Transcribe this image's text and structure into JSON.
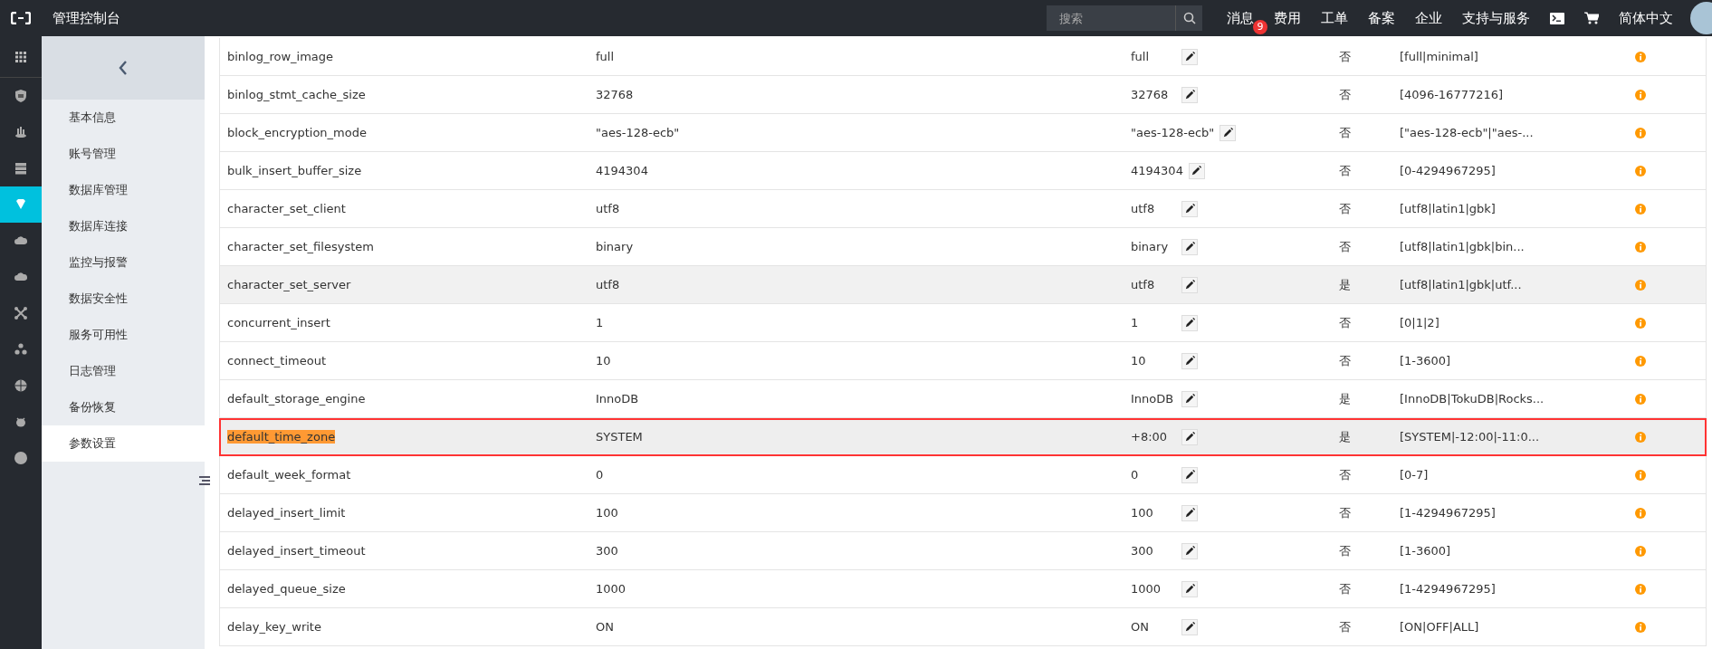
{
  "topbar": {
    "title": "管理控制台",
    "search": {
      "placeholder": "搜索"
    },
    "nav": [
      {
        "kind": "text",
        "label": "消息",
        "badge": "9"
      },
      {
        "kind": "text",
        "label": "费用"
      },
      {
        "kind": "text",
        "label": "工单"
      },
      {
        "kind": "text",
        "label": "备案"
      },
      {
        "kind": "text",
        "label": "企业"
      },
      {
        "kind": "text",
        "label": "支持与服务"
      },
      {
        "kind": "terminal"
      },
      {
        "kind": "cart"
      },
      {
        "kind": "text",
        "label": "简体中文"
      },
      {
        "kind": "avatar"
      }
    ]
  },
  "rail": {
    "items": [
      {
        "kind": "grid",
        "selected": false
      },
      {
        "kind": "shield",
        "selected": false
      },
      {
        "kind": "bars",
        "selected": false
      },
      {
        "kind": "server",
        "selected": false
      },
      {
        "kind": "gem",
        "selected": true
      },
      {
        "kind": "cloud",
        "selected": false
      },
      {
        "kind": "cloud",
        "selected": false
      },
      {
        "kind": "cross",
        "selected": false
      },
      {
        "kind": "nodes",
        "selected": false
      },
      {
        "kind": "globe",
        "selected": false
      },
      {
        "kind": "bug",
        "selected": false
      },
      {
        "kind": "dot",
        "selected": false
      }
    ]
  },
  "sidebar": {
    "items": [
      {
        "label": "基本信息",
        "selected": false
      },
      {
        "label": "账号管理",
        "selected": false
      },
      {
        "label": "数据库管理",
        "selected": false
      },
      {
        "label": "数据库连接",
        "selected": false
      },
      {
        "label": "监控与报警",
        "selected": false
      },
      {
        "label": "数据安全性",
        "selected": false
      },
      {
        "label": "服务可用性",
        "selected": false
      },
      {
        "label": "日志管理",
        "selected": false
      },
      {
        "label": "备份恢复",
        "selected": false
      },
      {
        "label": "参数设置",
        "selected": true
      }
    ]
  },
  "parameters": {
    "rows": [
      {
        "name": "binlog_row_image",
        "value": "full",
        "modified_value": "full",
        "restart": "否",
        "range": "[full|minimal]",
        "shaded": false,
        "highlighted": false,
        "name_marked": false
      },
      {
        "name": "binlog_stmt_cache_size",
        "value": "32768",
        "modified_value": "32768",
        "restart": "否",
        "range": "[4096-16777216]",
        "shaded": false,
        "highlighted": false,
        "name_marked": false
      },
      {
        "name": "block_encryption_mode",
        "value": "\"aes-128-ecb\"",
        "modified_value": "\"aes-128-ecb\"",
        "restart": "否",
        "range": "[\"aes-128-ecb\"|\"aes-...",
        "shaded": false,
        "highlighted": false,
        "name_marked": false
      },
      {
        "name": "bulk_insert_buffer_size",
        "value": "4194304",
        "modified_value": "4194304",
        "restart": "否",
        "range": "[0-4294967295]",
        "shaded": false,
        "highlighted": false,
        "name_marked": false
      },
      {
        "name": "character_set_client",
        "value": "utf8",
        "modified_value": "utf8",
        "restart": "否",
        "range": "[utf8|latin1|gbk]",
        "shaded": false,
        "highlighted": false,
        "name_marked": false
      },
      {
        "name": "character_set_filesystem",
        "value": "binary",
        "modified_value": "binary",
        "restart": "否",
        "range": "[utf8|latin1|gbk|bin...",
        "shaded": false,
        "highlighted": false,
        "name_marked": false
      },
      {
        "name": "character_set_server",
        "value": "utf8",
        "modified_value": "utf8",
        "restart": "是",
        "range": "[utf8|latin1|gbk|utf...",
        "shaded": true,
        "highlighted": false,
        "name_marked": false
      },
      {
        "name": "concurrent_insert",
        "value": "1",
        "modified_value": "1",
        "restart": "否",
        "range": "[0|1|2]",
        "shaded": false,
        "highlighted": false,
        "name_marked": false
      },
      {
        "name": "connect_timeout",
        "value": "10",
        "modified_value": "10",
        "restart": "否",
        "range": "[1-3600]",
        "shaded": false,
        "highlighted": false,
        "name_marked": false
      },
      {
        "name": "default_storage_engine",
        "value": "InnoDB",
        "modified_value": "InnoDB",
        "restart": "是",
        "range": "[InnoDB|TokuDB|Rocks...",
        "shaded": false,
        "highlighted": false,
        "name_marked": false
      },
      {
        "name": "default_time_zone",
        "value": "SYSTEM",
        "modified_value": "+8:00",
        "restart": "是",
        "range": "[SYSTEM|-12:00|-11:0...",
        "shaded": false,
        "highlighted": true,
        "name_marked": true
      },
      {
        "name": "default_week_format",
        "value": "0",
        "modified_value": "0",
        "restart": "否",
        "range": "[0-7]",
        "shaded": false,
        "highlighted": false,
        "name_marked": false
      },
      {
        "name": "delayed_insert_limit",
        "value": "100",
        "modified_value": "100",
        "restart": "否",
        "range": "[1-4294967295]",
        "shaded": false,
        "highlighted": false,
        "name_marked": false
      },
      {
        "name": "delayed_insert_timeout",
        "value": "300",
        "modified_value": "300",
        "restart": "否",
        "range": "[1-3600]",
        "shaded": false,
        "highlighted": false,
        "name_marked": false
      },
      {
        "name": "delayed_queue_size",
        "value": "1000",
        "modified_value": "1000",
        "restart": "否",
        "range": "[1-4294967295]",
        "shaded": false,
        "highlighted": false,
        "name_marked": false
      },
      {
        "name": "delay_key_write",
        "value": "ON",
        "modified_value": "ON",
        "restart": "否",
        "range": "[ON|OFF|ALL]",
        "shaded": false,
        "highlighted": false,
        "name_marked": false
      }
    ]
  }
}
